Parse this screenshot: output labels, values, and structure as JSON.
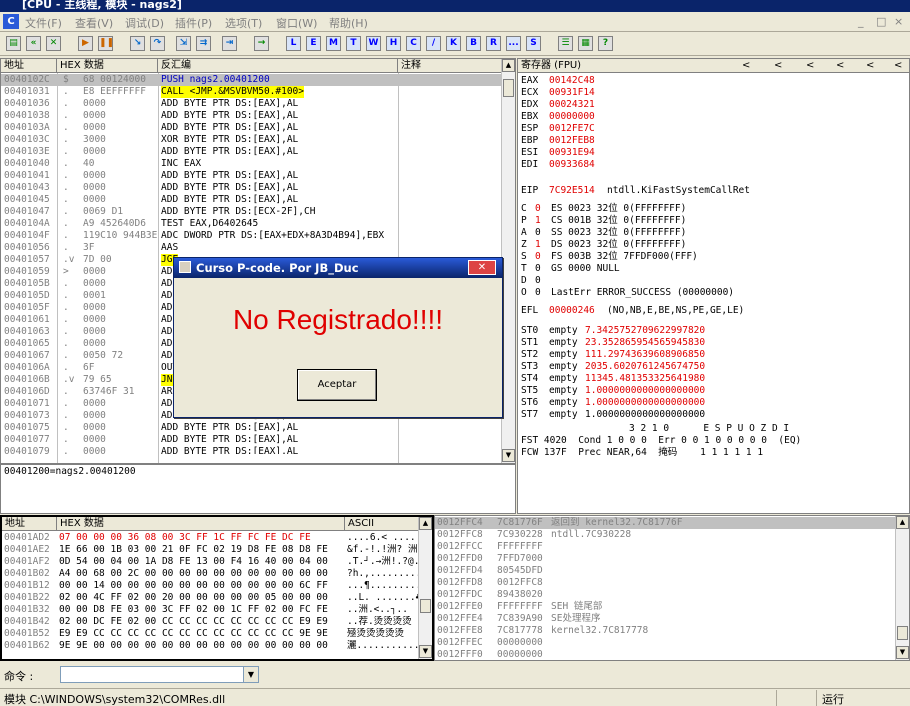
{
  "window": {
    "title": "[CPU - 主线程, 模块 - nags2]",
    "min": "_",
    "max": "□",
    "close": "×",
    "mdi_min": "_",
    "mdi_max": "□",
    "mdi_close": "×"
  },
  "menu": [
    "文件(F)",
    "查看(V)",
    "调试(D)",
    "插件(P)",
    "选项(T)",
    "窗口(W)",
    "帮助(H)"
  ],
  "toolbar": {
    "letters": [
      "L",
      "E",
      "M",
      "T",
      "W",
      "H",
      "C",
      "/",
      "K",
      "B",
      "R",
      "...",
      "S"
    ]
  },
  "disasm": {
    "headers": {
      "addr": "地址",
      "hex": "HEX 数据",
      "dis": "反汇编",
      "comment": "注释"
    },
    "rows": [
      {
        "a": "0040102C",
        "m": "$",
        "h": "68 00124000",
        "d": "PUSH nags2.00401200",
        "sel": true
      },
      {
        "a": "00401031",
        "m": ".",
        "h": "E8 EEFFFFFF",
        "d": "CALL <JMP.&MSVBVM50.#100>",
        "call": true
      },
      {
        "a": "00401036",
        "m": ".",
        "h": "0000",
        "d": "ADD BYTE PTR DS:[EAX],AL"
      },
      {
        "a": "00401038",
        "m": ".",
        "h": "0000",
        "d": "ADD BYTE PTR DS:[EAX],AL"
      },
      {
        "a": "0040103A",
        "m": ".",
        "h": "0000",
        "d": "ADD BYTE PTR DS:[EAX],AL"
      },
      {
        "a": "0040103C",
        "m": ".",
        "h": "3000",
        "d": "XOR BYTE PTR DS:[EAX],AL"
      },
      {
        "a": "0040103E",
        "m": ".",
        "h": "0000",
        "d": "ADD BYTE PTR DS:[EAX],AL"
      },
      {
        "a": "00401040",
        "m": ".",
        "h": "40",
        "d": "INC EAX"
      },
      {
        "a": "00401041",
        "m": ".",
        "h": "0000",
        "d": "ADD BYTE PTR DS:[EAX],AL"
      },
      {
        "a": "00401043",
        "m": ".",
        "h": "0000",
        "d": "ADD BYTE PTR DS:[EAX],AL"
      },
      {
        "a": "00401045",
        "m": ".",
        "h": "0000",
        "d": "ADD BYTE PTR DS:[EAX],AL"
      },
      {
        "a": "00401047",
        "m": ".",
        "h": "0069 D1",
        "d": "ADD BYTE PTR DS:[ECX-2F],CH"
      },
      {
        "a": "0040104A",
        "m": ".",
        "h": "A9 452640D6",
        "d": "TEST EAX,D6402645"
      },
      {
        "a": "0040104F",
        "m": ".",
        "h": "119C10 944B3E",
        "d": "ADC DWORD PTR DS:[EAX+EDX+8A3D4B94],EBX"
      },
      {
        "a": "00401056",
        "m": ".",
        "h": "3F",
        "d": "AAS"
      },
      {
        "a": "00401057",
        "m": ".v",
        "h": "7D 00",
        "d": "JGE",
        "jmp": true
      },
      {
        "a": "00401059",
        "m": ">",
        "h": "0000",
        "d": "ADD"
      },
      {
        "a": "0040105B",
        "m": ".",
        "h": "0000",
        "d": "ADD"
      },
      {
        "a": "0040105D",
        "m": ".",
        "h": "0001",
        "d": "ADD"
      },
      {
        "a": "0040105F",
        "m": ".",
        "h": "0000",
        "d": "ADD"
      },
      {
        "a": "00401061",
        "m": ".",
        "h": "0000",
        "d": "ADD"
      },
      {
        "a": "00401063",
        "m": ".",
        "h": "0000",
        "d": "ADD"
      },
      {
        "a": "00401065",
        "m": ".",
        "h": "0000",
        "d": "ADD"
      },
      {
        "a": "00401067",
        "m": ".",
        "h": "0050 72",
        "d": "ADD"
      },
      {
        "a": "0040106A",
        "m": ".",
        "h": "6F",
        "d": "OUT"
      },
      {
        "a": "0040106B",
        "m": ".v",
        "h": "79 65",
        "d": "JNS",
        "jmp": true
      },
      {
        "a": "0040106D",
        "m": ".",
        "h": "63746F 31",
        "d": "ARPL"
      },
      {
        "a": "00401071",
        "m": ".",
        "h": "0000",
        "d": "ADD"
      },
      {
        "a": "00401073",
        "m": ".",
        "h": "0000",
        "d": "ADD BYTE PTR DS:[EAX],AL"
      },
      {
        "a": "00401075",
        "m": ".",
        "h": "0000",
        "d": "ADD BYTE PTR DS:[EAX],AL"
      },
      {
        "a": "00401077",
        "m": ".",
        "h": "0000",
        "d": "ADD BYTE PTR DS:[EAX],AL"
      },
      {
        "a": "00401079",
        "m": ".",
        "h": "0000",
        "d": "ADD BYTE PTR DS:[EAX],AL"
      }
    ],
    "info": "00401200=nags2.00401200"
  },
  "registers": {
    "title": "寄存器 (FPU)",
    "nav": [
      "<",
      "<",
      "<",
      "<",
      "<",
      "<"
    ],
    "gp": [
      {
        "n": "EAX",
        "v": "00142C48",
        "x": ""
      },
      {
        "n": "ECX",
        "v": "00931F14",
        "x": ""
      },
      {
        "n": "EDX",
        "v": "00024321",
        "x": ""
      },
      {
        "n": "EBX",
        "v": "00000000",
        "x": ""
      },
      {
        "n": "ESP",
        "v": "0012FE7C",
        "x": ""
      },
      {
        "n": "EBP",
        "v": "0012FEB8",
        "x": ""
      },
      {
        "n": "ESI",
        "v": "00931E94",
        "x": ""
      },
      {
        "n": "EDI",
        "v": "00933684",
        "x": ""
      }
    ],
    "eip": {
      "n": "EIP",
      "v": "7C92E514",
      "x": "ntdll.KiFastSystemCallRet"
    },
    "flags": [
      {
        "f": "C",
        "b": "0",
        "r": "ES 0023 32位 0(FFFFFFFF)",
        "red": true
      },
      {
        "f": "P",
        "b": "1",
        "r": "CS 001B 32位 0(FFFFFFFF)",
        "red": true
      },
      {
        "f": "A",
        "b": "0",
        "r": "SS 0023 32位 0(FFFFFFFF)",
        "red": false
      },
      {
        "f": "Z",
        "b": "1",
        "r": "DS 0023 32位 0(FFFFFFFF)",
        "red": true
      },
      {
        "f": "S",
        "b": "0",
        "r": "FS 003B 32位 7FFDF000(FFF)",
        "red": true
      },
      {
        "f": "T",
        "b": "0",
        "r": "GS 0000 NULL",
        "red": false
      },
      {
        "f": "D",
        "b": "0",
        "r": "",
        "red": false
      },
      {
        "f": "O",
        "b": "0",
        "r": "LastErr ERROR_SUCCESS (00000000)",
        "red": false
      }
    ],
    "efl": {
      "n": "EFL",
      "v": "00000246",
      "x": "(NO,NB,E,BE,NS,PE,GE,LE)"
    },
    "fpu": [
      {
        "n": "ST0",
        "s": "empty",
        "v": "7.3425752709622997820"
      },
      {
        "n": "ST1",
        "s": "empty",
        "v": "23.352865954565945830"
      },
      {
        "n": "ST2",
        "s": "empty",
        "v": "111.29743639608906850"
      },
      {
        "n": "ST3",
        "s": "empty",
        "v": "2035.6020761245674750"
      },
      {
        "n": "ST4",
        "s": "empty",
        "v": "11345.481353325641980"
      },
      {
        "n": "ST5",
        "s": "empty",
        "v": "1.0000000000000000000"
      },
      {
        "n": "ST6",
        "s": "empty",
        "v": "1.0000000000000000000"
      },
      {
        "n": "ST7",
        "s": "empty",
        "v": "1.0000000000000000000",
        "black": true
      }
    ],
    "fst_header": "3 2 1 0      E S P U O Z D I",
    "fst": "FST 4020  Cond 1 0 0 0  Err 0 0 1 0 0 0 0 0  (EQ)",
    "fcw": "FCW 137F  Prec NEAR,64  掩码    1 1 1 1 1 1"
  },
  "dump": {
    "headers": {
      "addr": "地址",
      "hex": "HEX 数据",
      "ascii": "ASCII"
    },
    "rows": [
      {
        "a": "00401AD2",
        "h": "07 00 00 00 36 08 00 3C FF 1C FF FC FE DC FE",
        "s": "....6.< ...."
      },
      {
        "a": "00401AE2",
        "h": "1E 66 00 1B 03 00 21 0F FC 02 19 D8 FE 08 D8 FE",
        "s": "&f.-!.!洲? 洲"
      },
      {
        "a": "00401AF2",
        "h": "0D 54 00 04 00 1A D8 FE 13 00 F4 16 40 00 04 00",
        "s": ".T.┘.→洲!.?@."
      },
      {
        "a": "00401B02",
        "h": "A4 00 68 00 2C 00 00 00 00 00 00 00 00 00 00 00",
        "s": "?h.,..........."
      },
      {
        "a": "00401B12",
        "h": "00 00 14 00 00 00 00 00 00 00 00 00 00 00 6C FF",
        "s": "...¶.........l."
      },
      {
        "a": "00401B22",
        "h": "02 00 4C FF 02 00 20 00 00 00 00 00 05 00 00 00",
        "s": "..L. .......♣.."
      },
      {
        "a": "00401B32",
        "h": "00 00 D8 FE 03 00 3C FF 02 00 1C FF 02 00 FC FE",
        "s": "..洲.<..┐.."
      },
      {
        "a": "00401B42",
        "h": "02 00 DC FE 02 00 CC CC CC CC CC CC CC CC E9 E9",
        "s": "..荐.烫烫烫烫"
      },
      {
        "a": "00401B52",
        "h": "E9 E9 CC CC CC CC CC CC CC CC CC CC CC CC 9E 9E",
        "s": "殛烫烫烫烫烫"
      },
      {
        "a": "00401B62",
        "h": "9E 9E 00 00 00 00 00 00 00 00 00 00 00 00 00 00",
        "s": "灑............"
      }
    ]
  },
  "stack": {
    "rows": [
      {
        "a": "0012FFC4",
        "v": "7C81776F",
        "c": "返回到 kernel32.7C81776F",
        "sel": true
      },
      {
        "a": "0012FFC8",
        "v": "7C930228",
        "c": "ntdll.7C930228"
      },
      {
        "a": "0012FFCC",
        "v": "FFFFFFFF",
        "c": ""
      },
      {
        "a": "0012FFD0",
        "v": "7FFD7000",
        "c": ""
      },
      {
        "a": "0012FFD4",
        "v": "80545DFD",
        "c": ""
      },
      {
        "a": "0012FFD8",
        "v": "0012FFC8",
        "c": ""
      },
      {
        "a": "0012FFDC",
        "v": "89438020",
        "c": ""
      },
      {
        "a": "0012FFE0",
        "v": "FFFFFFFF",
        "c": "SEH 链尾部"
      },
      {
        "a": "0012FFE4",
        "v": "7C839A90",
        "c": "SE处理程序"
      },
      {
        "a": "0012FFE8",
        "v": "7C817778",
        "c": "kernel32.7C817778"
      },
      {
        "a": "0012FFEC",
        "v": "00000000",
        "c": ""
      },
      {
        "a": "0012FFF0",
        "v": "00000000",
        "c": ""
      }
    ]
  },
  "command": {
    "label": "命令 :",
    "value": ""
  },
  "status": {
    "module": "模块 C:\\WINDOWS\\system32\\COMRes.dll",
    "state": "运行"
  },
  "dialog": {
    "title": "Curso P-code. Por JB_Duc",
    "message": "No Registrado!!!!",
    "button": "Aceptar",
    "close": "✕"
  }
}
